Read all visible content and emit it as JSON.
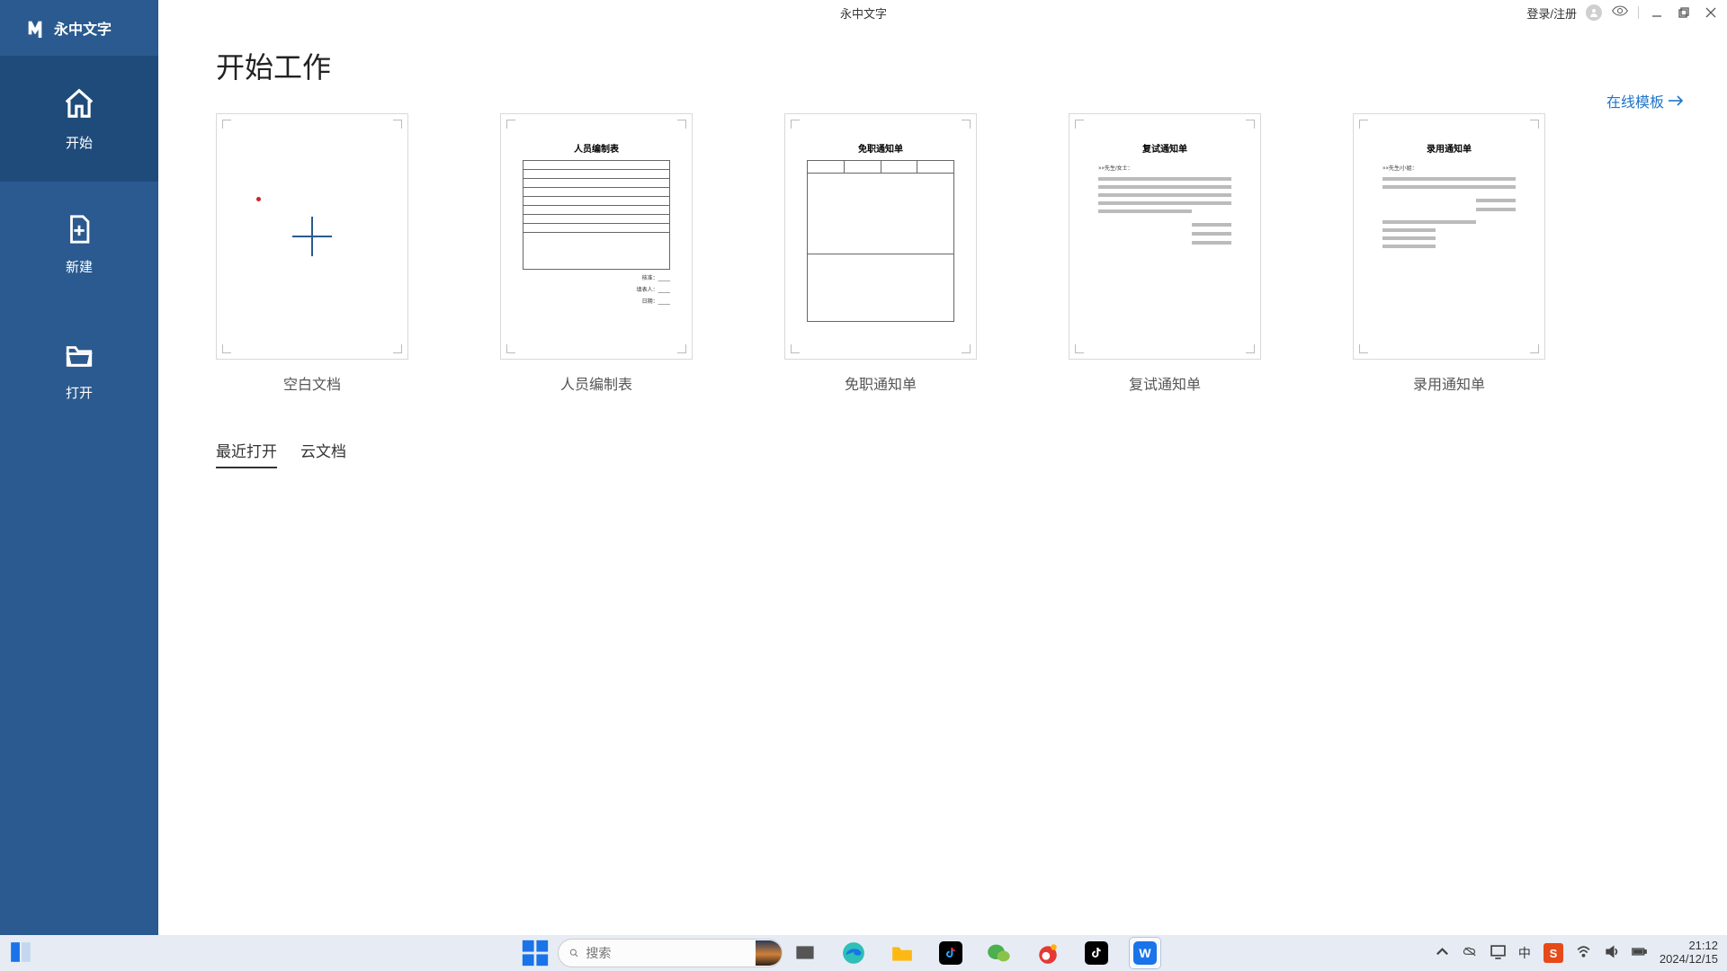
{
  "app": {
    "title": "永中文字",
    "brand_name": "永中文字"
  },
  "titlebar": {
    "login": "登录/注册"
  },
  "sidebar": {
    "items": [
      {
        "label": "开始"
      },
      {
        "label": "新建"
      },
      {
        "label": "打开"
      }
    ]
  },
  "main": {
    "page_title": "开始工作",
    "online_templates": "在线模板",
    "tabs": [
      {
        "label": "最近打开"
      },
      {
        "label": "云文档"
      }
    ]
  },
  "templates": [
    {
      "label": "空白文档",
      "preview_title": ""
    },
    {
      "label": "人员编制表",
      "preview_title": "人员编制表"
    },
    {
      "label": "免职通知单",
      "preview_title": "免职通知单"
    },
    {
      "label": "复试通知单",
      "preview_title": "复试通知单"
    },
    {
      "label": "录用通知单",
      "preview_title": "录用通知单"
    }
  ],
  "taskbar": {
    "search_placeholder": "搜索",
    "time": "21:12",
    "date": "2024/12/15",
    "ime": "中"
  }
}
